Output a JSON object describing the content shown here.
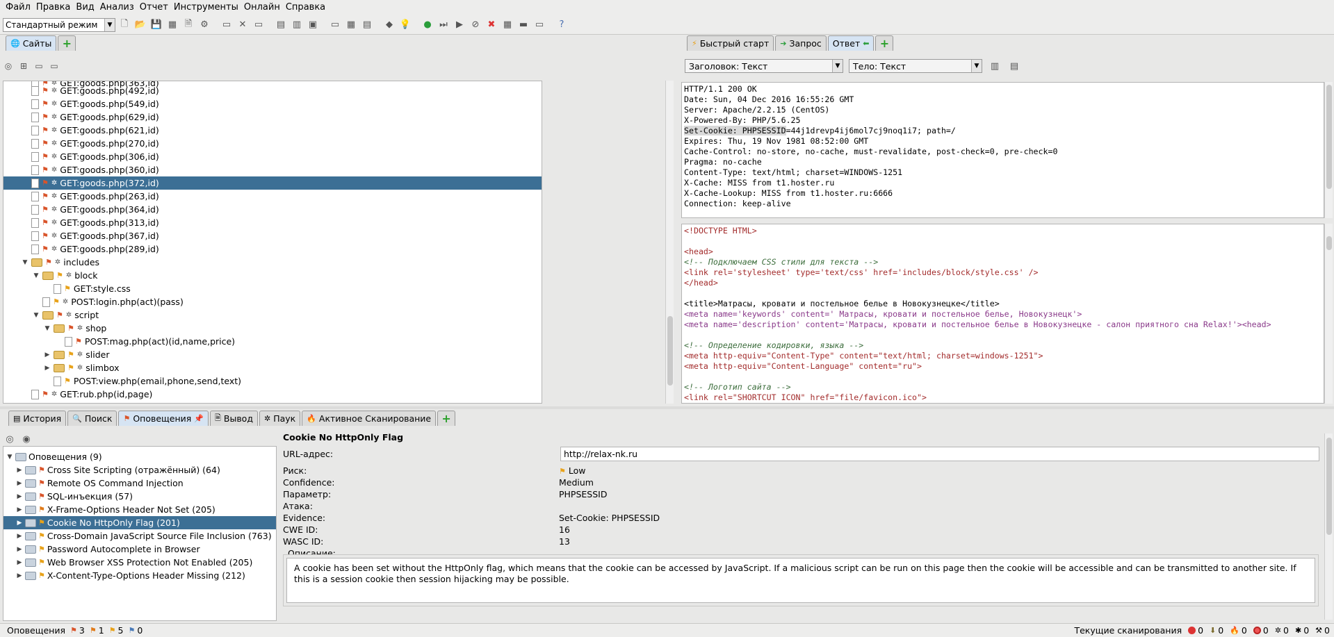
{
  "menu": [
    "Файл",
    "Правка",
    "Вид",
    "Анализ",
    "Отчет",
    "Инструменты",
    "Онлайн",
    "Справка"
  ],
  "toolbar": {
    "mode": "Стандартный режим"
  },
  "sites": {
    "tab_label": "Сайты",
    "rows": [
      {
        "label": "GET:goods.php(492,id)"
      },
      {
        "label": "GET:goods.php(549,id)"
      },
      {
        "label": "GET:goods.php(629,id)"
      },
      {
        "label": "GET:goods.php(621,id)"
      },
      {
        "label": "GET:goods.php(270,id)"
      },
      {
        "label": "GET:goods.php(306,id)"
      },
      {
        "label": "GET:goods.php(360,id)"
      },
      {
        "label": "GET:goods.php(372,id)"
      },
      {
        "label": "GET:goods.php(263,id)"
      },
      {
        "label": "GET:goods.php(364,id)"
      },
      {
        "label": "GET:goods.php(313,id)"
      },
      {
        "label": "GET:goods.php(367,id)"
      },
      {
        "label": "GET:goods.php(289,id)"
      },
      {
        "label": "includes"
      },
      {
        "label": "block"
      },
      {
        "label": "GET:style.css"
      },
      {
        "label": "POST:login.php(act)(pass)"
      },
      {
        "label": "script"
      },
      {
        "label": "shop"
      },
      {
        "label": "POST:mag.php(act)(id,name,price)"
      },
      {
        "label": "slider"
      },
      {
        "label": "slimbox"
      },
      {
        "label": "POST:view.php(email,phone,send,text)"
      },
      {
        "label": "GET:rub.php(id,page)"
      }
    ]
  },
  "response": {
    "tabs": [
      "Быстрый старт",
      "Запрос",
      "Ответ"
    ],
    "header_view": "Заголовок: Текст",
    "body_view": "Тело: Текст",
    "header_lines": [
      "HTTP/1.1 200 OK",
      "Date: Sun, 04 Dec 2016 16:55:26 GMT",
      "Server: Apache/2.2.15 (CentOS)",
      "X-Powered-By: PHP/5.6.25",
      "Set-Cookie: PHPSESSID",
      "=44j1drevp4ij6mol7cj9noq1i7; path=/",
      "Expires: Thu, 19 Nov 1981 08:52:00 GMT",
      "Cache-Control: no-store, no-cache, must-revalidate, post-check=0, pre-check=0",
      "Pragma: no-cache",
      "Content-Type: text/html; charset=WINDOWS-1251",
      "X-Cache: MISS from t1.hoster.ru",
      "X-Cache-Lookup: MISS from t1.hoster.ru:6666",
      "Connection: keep-alive"
    ],
    "body_lines": [
      "<!DOCTYPE HTML>",
      "",
      "<head>",
      "<!--  Подключаем CSS стили для текста  -->",
      "<link rel='stylesheet' type='text/css' href='includes/block/style.css' />",
      "</head>",
      "",
      "<title>Матрасы, кровати и постельное белье в Новокузнецке</title>",
      "<meta name='keywords' content=' Матрасы, кровати и постельное белье, Новокузнецк'>",
      "<meta name='description' content='Матрасы, кровати и постельное белье в Новокузнецке - салон приятного сна Relax!'><head>",
      "",
      "<!--  Определение кодировки, языка  -->",
      "<meta http-equiv=\"Content-Type\" content=\"text/html; charset=windows-1251\">",
      "<meta http-equiv=\"Content-Language\" content=\"ru\">",
      "",
      "<!--  Логотип сайта  -->",
      "<link rel=\"SHORTCUT ICON\" href=\"file/favicon.ico\">"
    ]
  },
  "bottom_tabs": [
    "История",
    "Поиск",
    "Оповещения",
    "Вывод",
    "Паук",
    "Активное Сканирование"
  ],
  "alerts": {
    "root": "Оповещения (9)",
    "items": [
      {
        "label": "Cross Site Scripting (отражённый) (64)",
        "risk": "high"
      },
      {
        "label": "Remote OS Command Injection",
        "risk": "high"
      },
      {
        "label": "SQL-инъекция (57)",
        "risk": "high"
      },
      {
        "label": "X-Frame-Options Header Not Set (205)",
        "risk": "medium"
      },
      {
        "label": "Cookie No HttpOnly Flag (201)",
        "risk": "low"
      },
      {
        "label": "Cross-Domain JavaScript Source File Inclusion (763)",
        "risk": "low"
      },
      {
        "label": "Password Autocomplete in Browser",
        "risk": "low"
      },
      {
        "label": "Web Browser XSS Protection Not Enabled (205)",
        "risk": "low"
      },
      {
        "label": "X-Content-Type-Options Header Missing (212)",
        "risk": "low"
      }
    ]
  },
  "detail": {
    "title": "Cookie No HttpOnly Flag",
    "url_label": "URL-адрес:",
    "url_value": "http://relax-nk.ru",
    "risk_label": "Риск:",
    "risk_value": "Low",
    "confidence_label": "Confidence:",
    "confidence_value": "Medium",
    "param_label": "Параметр:",
    "param_value": "PHPSESSID",
    "attack_label": "Атака:",
    "attack_value": "",
    "evidence_label": "Evidence:",
    "evidence_value": "Set-Cookie: PHPSESSID",
    "cwe_label": "CWE ID:",
    "cwe_value": "16",
    "wasc_label": "WASC ID:",
    "wasc_value": "13",
    "desc_label": "Описание:",
    "description": "A cookie has been set without the HttpOnly flag, which means that the cookie can be accessed by JavaScript. If a malicious script can be run on this page then the cookie will be accessible and can be transmitted to another site. If this is a session cookie then session hijacking may be possible."
  },
  "status": {
    "alerts_label": "Оповещения",
    "high": "3",
    "medium": "1",
    "low": "5",
    "info": "0",
    "scans_label": "Текущие сканирования",
    "scan_counts": [
      "0",
      "0",
      "0",
      "0",
      "0",
      "0",
      "0"
    ]
  }
}
